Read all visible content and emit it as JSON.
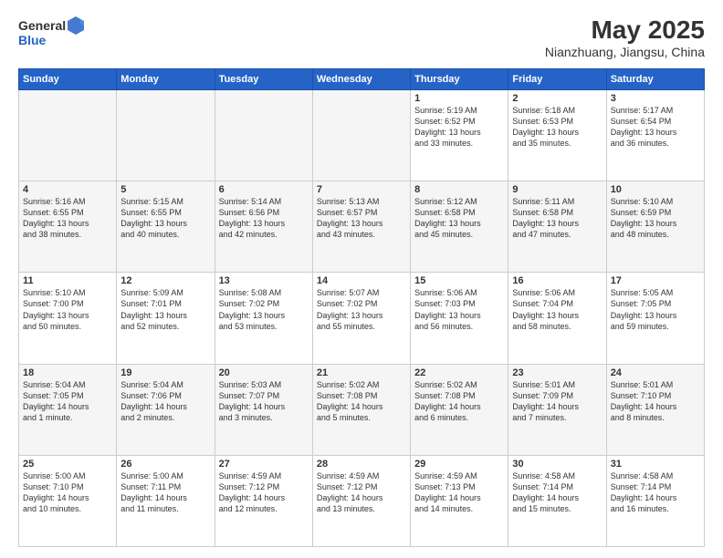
{
  "header": {
    "logo": {
      "line1": "General",
      "line2": "Blue"
    },
    "title": "May 2025",
    "location": "Nianzhuang, Jiangsu, China"
  },
  "days_of_week": [
    "Sunday",
    "Monday",
    "Tuesday",
    "Wednesday",
    "Thursday",
    "Friday",
    "Saturday"
  ],
  "weeks": [
    {
      "row_class": "row-1",
      "days": [
        {
          "num": "",
          "info": ""
        },
        {
          "num": "",
          "info": ""
        },
        {
          "num": "",
          "info": ""
        },
        {
          "num": "",
          "info": ""
        },
        {
          "num": "1",
          "info": "Sunrise: 5:19 AM\nSunset: 6:52 PM\nDaylight: 13 hours\nand 33 minutes."
        },
        {
          "num": "2",
          "info": "Sunrise: 5:18 AM\nSunset: 6:53 PM\nDaylight: 13 hours\nand 35 minutes."
        },
        {
          "num": "3",
          "info": "Sunrise: 5:17 AM\nSunset: 6:54 PM\nDaylight: 13 hours\nand 36 minutes."
        }
      ]
    },
    {
      "row_class": "row-2",
      "days": [
        {
          "num": "4",
          "info": "Sunrise: 5:16 AM\nSunset: 6:55 PM\nDaylight: 13 hours\nand 38 minutes."
        },
        {
          "num": "5",
          "info": "Sunrise: 5:15 AM\nSunset: 6:55 PM\nDaylight: 13 hours\nand 40 minutes."
        },
        {
          "num": "6",
          "info": "Sunrise: 5:14 AM\nSunset: 6:56 PM\nDaylight: 13 hours\nand 42 minutes."
        },
        {
          "num": "7",
          "info": "Sunrise: 5:13 AM\nSunset: 6:57 PM\nDaylight: 13 hours\nand 43 minutes."
        },
        {
          "num": "8",
          "info": "Sunrise: 5:12 AM\nSunset: 6:58 PM\nDaylight: 13 hours\nand 45 minutes."
        },
        {
          "num": "9",
          "info": "Sunrise: 5:11 AM\nSunset: 6:58 PM\nDaylight: 13 hours\nand 47 minutes."
        },
        {
          "num": "10",
          "info": "Sunrise: 5:10 AM\nSunset: 6:59 PM\nDaylight: 13 hours\nand 48 minutes."
        }
      ]
    },
    {
      "row_class": "row-3",
      "days": [
        {
          "num": "11",
          "info": "Sunrise: 5:10 AM\nSunset: 7:00 PM\nDaylight: 13 hours\nand 50 minutes."
        },
        {
          "num": "12",
          "info": "Sunrise: 5:09 AM\nSunset: 7:01 PM\nDaylight: 13 hours\nand 52 minutes."
        },
        {
          "num": "13",
          "info": "Sunrise: 5:08 AM\nSunset: 7:02 PM\nDaylight: 13 hours\nand 53 minutes."
        },
        {
          "num": "14",
          "info": "Sunrise: 5:07 AM\nSunset: 7:02 PM\nDaylight: 13 hours\nand 55 minutes."
        },
        {
          "num": "15",
          "info": "Sunrise: 5:06 AM\nSunset: 7:03 PM\nDaylight: 13 hours\nand 56 minutes."
        },
        {
          "num": "16",
          "info": "Sunrise: 5:06 AM\nSunset: 7:04 PM\nDaylight: 13 hours\nand 58 minutes."
        },
        {
          "num": "17",
          "info": "Sunrise: 5:05 AM\nSunset: 7:05 PM\nDaylight: 13 hours\nand 59 minutes."
        }
      ]
    },
    {
      "row_class": "row-4",
      "days": [
        {
          "num": "18",
          "info": "Sunrise: 5:04 AM\nSunset: 7:05 PM\nDaylight: 14 hours\nand 1 minute."
        },
        {
          "num": "19",
          "info": "Sunrise: 5:04 AM\nSunset: 7:06 PM\nDaylight: 14 hours\nand 2 minutes."
        },
        {
          "num": "20",
          "info": "Sunrise: 5:03 AM\nSunset: 7:07 PM\nDaylight: 14 hours\nand 3 minutes."
        },
        {
          "num": "21",
          "info": "Sunrise: 5:02 AM\nSunset: 7:08 PM\nDaylight: 14 hours\nand 5 minutes."
        },
        {
          "num": "22",
          "info": "Sunrise: 5:02 AM\nSunset: 7:08 PM\nDaylight: 14 hours\nand 6 minutes."
        },
        {
          "num": "23",
          "info": "Sunrise: 5:01 AM\nSunset: 7:09 PM\nDaylight: 14 hours\nand 7 minutes."
        },
        {
          "num": "24",
          "info": "Sunrise: 5:01 AM\nSunset: 7:10 PM\nDaylight: 14 hours\nand 8 minutes."
        }
      ]
    },
    {
      "row_class": "row-5",
      "days": [
        {
          "num": "25",
          "info": "Sunrise: 5:00 AM\nSunset: 7:10 PM\nDaylight: 14 hours\nand 10 minutes."
        },
        {
          "num": "26",
          "info": "Sunrise: 5:00 AM\nSunset: 7:11 PM\nDaylight: 14 hours\nand 11 minutes."
        },
        {
          "num": "27",
          "info": "Sunrise: 4:59 AM\nSunset: 7:12 PM\nDaylight: 14 hours\nand 12 minutes."
        },
        {
          "num": "28",
          "info": "Sunrise: 4:59 AM\nSunset: 7:12 PM\nDaylight: 14 hours\nand 13 minutes."
        },
        {
          "num": "29",
          "info": "Sunrise: 4:59 AM\nSunset: 7:13 PM\nDaylight: 14 hours\nand 14 minutes."
        },
        {
          "num": "30",
          "info": "Sunrise: 4:58 AM\nSunset: 7:14 PM\nDaylight: 14 hours\nand 15 minutes."
        },
        {
          "num": "31",
          "info": "Sunrise: 4:58 AM\nSunset: 7:14 PM\nDaylight: 14 hours\nand 16 minutes."
        }
      ]
    }
  ]
}
